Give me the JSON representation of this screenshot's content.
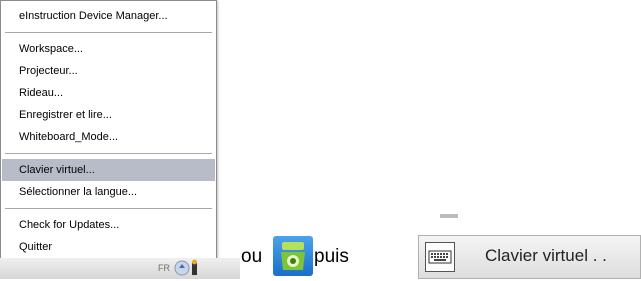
{
  "menu": {
    "items": [
      {
        "label": "eInstruction Device Manager..."
      },
      {
        "label": "Workspace..."
      },
      {
        "label": "Projecteur..."
      },
      {
        "label": "Rideau..."
      },
      {
        "label": "Enregistrer et lire..."
      },
      {
        "label": "Whiteboard_Mode..."
      },
      {
        "label": "Clavier virtuel...",
        "highlighted": true
      },
      {
        "label": "Sélectionner la langue..."
      },
      {
        "label": "Check for Updates..."
      },
      {
        "label": "Quitter"
      }
    ]
  },
  "tray": {
    "lang": "FR"
  },
  "text": {
    "or": "ou",
    "then": "puis"
  },
  "keyboard_button": {
    "label": "Clavier virtuel . ."
  },
  "colors": {
    "highlight": "#b8bcc8",
    "app_icon": "#2b85dc"
  }
}
